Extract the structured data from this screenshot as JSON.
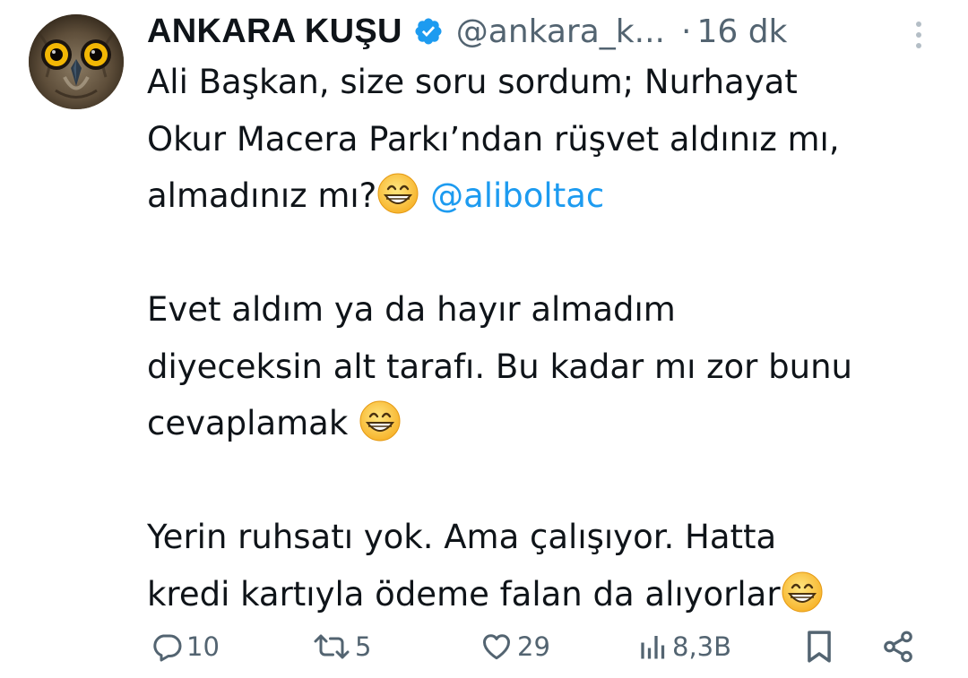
{
  "author": {
    "display_name": "ANKARA KUŞU",
    "handle": "@ankara_k...",
    "time_separator": "·",
    "time": "16 dk",
    "verified": true,
    "verified_color": "#1d9bf0",
    "avatar_icon": "owl-avatar-icon"
  },
  "tweet": {
    "line1": "Ali Başkan, size soru sordum; Nurhayat",
    "line2": "Okur Macera Parkı’ndan rüşvet aldınız mı,",
    "line3_text": "almadınız mı?",
    "line3_mention": "@aliboltac",
    "line5": "Evet aldım ya da hayır almadım",
    "line6": "diyeceksin alt tarafı. Bu kadar mı zor bunu",
    "line7": "cevaplamak ",
    "line9": "Yerin ruhsatı yok. Ama çalışıyor. Hatta",
    "line10": "kredi kartıyla ödeme falan da alıyorlar",
    "emoji_icon": "grinning-face-emoji-icon"
  },
  "actions": {
    "reply_count": "10",
    "retweet_count": "5",
    "like_count": "29",
    "views_count": "8,3B"
  },
  "colors": {
    "text": "#0f1419",
    "secondary": "#536471",
    "accent": "#1d9bf0"
  }
}
